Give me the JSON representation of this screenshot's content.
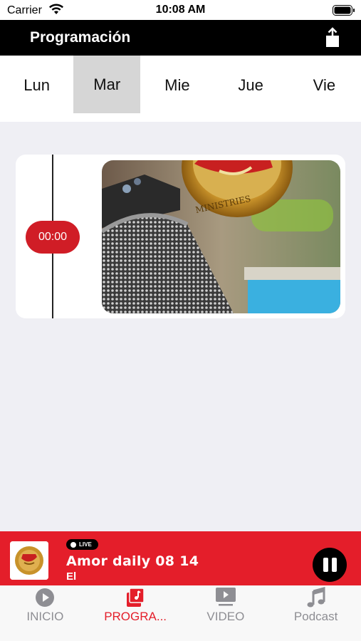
{
  "status_bar": {
    "carrier": "Carrier",
    "time": "10:08 AM"
  },
  "nav": {
    "title": "Programación",
    "share_icon": "share-icon"
  },
  "days": [
    {
      "label": "Lun",
      "selected": false
    },
    {
      "label": "Mar",
      "selected": true
    },
    {
      "label": "Mie",
      "selected": false
    },
    {
      "label": "Jue",
      "selected": false
    },
    {
      "label": "Vie",
      "selected": false
    }
  ],
  "program": {
    "time": "00:00",
    "image_text": "MINISTRIES"
  },
  "player": {
    "live_label": "LIVE",
    "title": "Amor daily 08 14",
    "subtitle": "El",
    "state": "playing"
  },
  "tabs": [
    {
      "label": "INICIO",
      "icon": "play-circle-icon",
      "active": false
    },
    {
      "label": "PROGRA...",
      "icon": "music-library-icon",
      "active": true
    },
    {
      "label": "VIDEO",
      "icon": "video-icon",
      "active": false
    },
    {
      "label": "Podcast",
      "icon": "music-note-icon",
      "active": false
    }
  ],
  "colors": {
    "accent": "#e41e2a",
    "nav_bg": "#000000",
    "badge": "#d01d26"
  }
}
